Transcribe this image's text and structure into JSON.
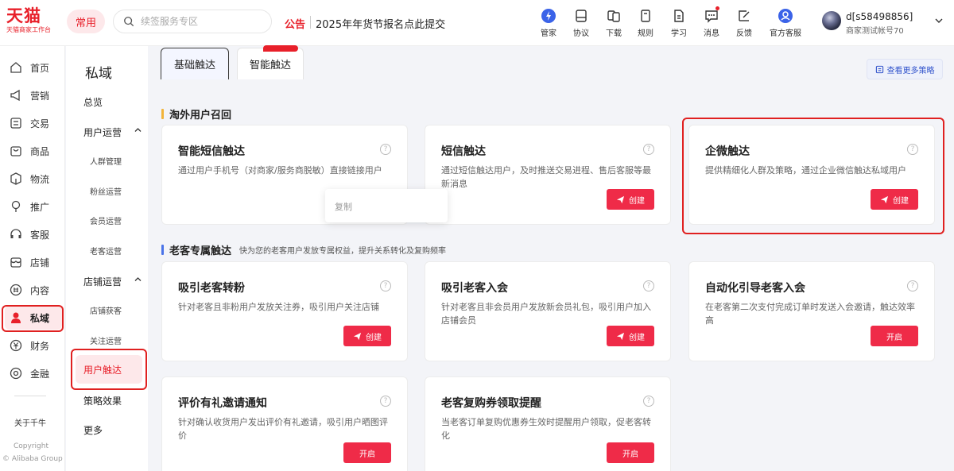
{
  "header": {
    "logo_main": "天猫",
    "logo_sub": "天猫商家工作台",
    "common_label": "常用",
    "search_placeholder": "续签服务专区",
    "notice_tag": "公告",
    "notice_text": "2025年年货节报名点此提交",
    "nav": [
      {
        "label": "管家",
        "icon": "butler-icon"
      },
      {
        "label": "协议",
        "icon": "agreement-icon"
      },
      {
        "label": "下载",
        "icon": "download-icon"
      },
      {
        "label": "规则",
        "icon": "rules-icon"
      },
      {
        "label": "学习",
        "icon": "learning-icon"
      },
      {
        "label": "消息",
        "icon": "message-icon"
      },
      {
        "label": "反馈",
        "icon": "feedback-icon"
      },
      {
        "label": "官方客服",
        "icon": "customer-service-icon"
      }
    ],
    "user_name": "d[s58498856]",
    "user_sub": "商家测试帐号70"
  },
  "sidebar": {
    "items": [
      {
        "label": "首页",
        "icon": "home-icon"
      },
      {
        "label": "营销",
        "icon": "marketing-icon"
      },
      {
        "label": "交易",
        "icon": "trade-icon"
      },
      {
        "label": "商品",
        "icon": "product-icon"
      },
      {
        "label": "物流",
        "icon": "logistics-icon"
      },
      {
        "label": "推广",
        "icon": "promotion-icon"
      },
      {
        "label": "客服",
        "icon": "service-icon"
      },
      {
        "label": "店铺",
        "icon": "store-icon"
      },
      {
        "label": "内容",
        "icon": "content-icon"
      },
      {
        "label": "私域",
        "icon": "private-domain-icon"
      },
      {
        "label": "财务",
        "icon": "finance-icon"
      },
      {
        "label": "金融",
        "icon": "banking-icon"
      }
    ],
    "about": "关于千牛",
    "copyright": "Copyright",
    "company": "© Alibaba Group"
  },
  "subnav": {
    "title": "私域",
    "overview": "总览",
    "user_ops": "用户运营",
    "crowd": "人群管理",
    "fans": "粉丝运营",
    "member": "会员运营",
    "old_customer": "老客运营",
    "store_ops": "店铺运营",
    "store_acquire": "店铺获客",
    "follow": "关注运营",
    "user_reach": "用户触达",
    "strategy": "策略效果",
    "more": "更多"
  },
  "tabs": {
    "basic": "基础触达",
    "smart": "智能触达"
  },
  "more_strategy": "查看更多策略",
  "sections": {
    "overseas": "淘外用户召回",
    "old": "老客专属触达",
    "old_sub": "快为您的老客用户发放专属权益，提升关系转化及复购频率"
  },
  "cards": {
    "sms_smart": {
      "title": "智能短信触达",
      "desc": "通过用户手机号（对商家/服务商脱敏）直接链接用户"
    },
    "sms": {
      "title": "短信触达",
      "desc": "通过短信触达用户，及时推送交易进程、售后客服等最新消息",
      "btn": "创建"
    },
    "wecom": {
      "title": "企微触达",
      "desc": "提供精细化人群及策略，通过企业微信触达私域用户",
      "btn": "创建"
    },
    "fans": {
      "title": "吸引老客转粉",
      "desc": "针对老客且非粉用户发放关注券，吸引用户关注店铺",
      "btn": "创建"
    },
    "member": {
      "title": "吸引老客入会",
      "desc": "针对老客且非会员用户发放新会员礼包，吸引用户加入店铺会员",
      "btn": "创建"
    },
    "auto_member": {
      "title": "自动化引导老客入会",
      "desc": "在老客第二次支付完成订单时发送入会邀请，触达效率高",
      "btn": "开启"
    },
    "review": {
      "title": "评价有礼邀请通知",
      "desc": "针对确认收货用户发出评价有礼邀请，吸引用户晒图评价",
      "btn": "开启"
    },
    "coupon": {
      "title": "老客复购券领取提醒",
      "desc": "当老客订单复购优惠券生效时提醒用户领取，促老客转化",
      "btn": "开启"
    }
  },
  "copy_popup": "复制",
  "colors": {
    "brand": "#e8202a",
    "button": "#ef2b48",
    "highlight": "#e02020"
  }
}
